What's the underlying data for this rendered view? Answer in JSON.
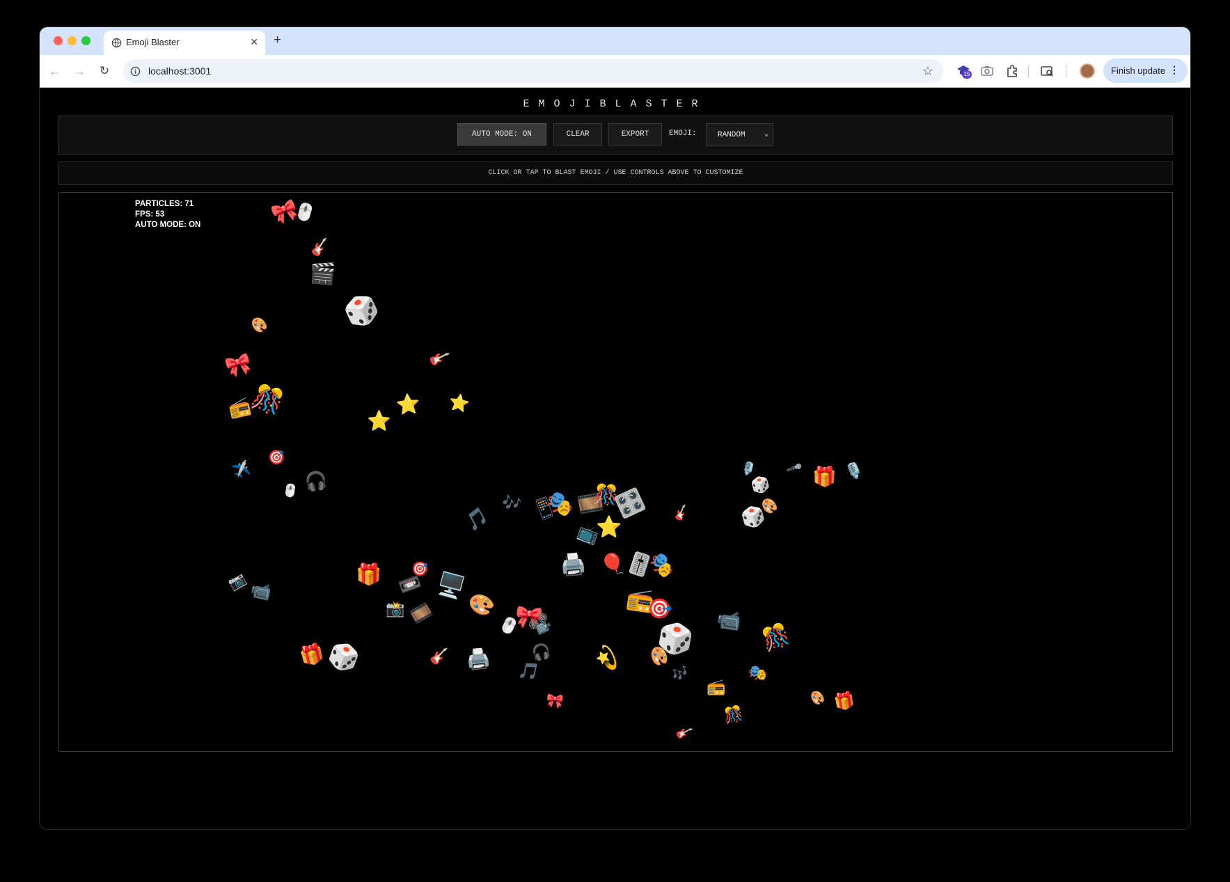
{
  "browser": {
    "tab_title": "Emoji Blaster",
    "close_glyph": "✕",
    "new_tab_glyph": "+",
    "back_glyph": "←",
    "forward_glyph": "→",
    "reload_glyph": "↻",
    "url": "localhost:3001",
    "star_glyph": "☆",
    "extension_badge": "15",
    "update_label": "Finish update",
    "menu_glyph": "⋮"
  },
  "app": {
    "title": "EMOJIBLASTER",
    "controls": {
      "auto_mode_label": "AUTO MODE: ON",
      "clear_label": "CLEAR",
      "export_label": "EXPORT",
      "emoji_label": "EMOJI:",
      "emoji_selected": "RANDOM",
      "caret_glyph": "⌄"
    },
    "instructions": "CLICK OR TAP TO BLAST EMOJI / USE CONTROLS ABOVE TO CUSTOMIZE",
    "stats": {
      "particles": "PARTICLES: 71",
      "fps": "FPS: 53",
      "auto_mode": "AUTO MODE: ON"
    }
  },
  "particles": [
    [
      "🎀",
      30
    ],
    [
      "🖱️",
      24
    ],
    [
      "🎸",
      22
    ],
    [
      "🎬",
      30
    ],
    [
      "🎲",
      40
    ],
    [
      "🎨",
      20
    ],
    [
      "🎀",
      30
    ],
    [
      "🎸",
      22
    ],
    [
      "⭐",
      28
    ],
    [
      "⭐",
      28
    ],
    [
      "📻",
      26
    ],
    [
      "🎊",
      36
    ],
    [
      "🎙️",
      18
    ],
    [
      "✈️",
      20
    ],
    [
      "🖱️",
      18
    ],
    [
      "🎧",
      26
    ],
    [
      "🎤",
      16
    ],
    [
      "🎁",
      28
    ],
    [
      "🎵",
      26
    ],
    [
      "🎶",
      22
    ],
    [
      "📱",
      28
    ],
    [
      "🎭",
      32
    ],
    [
      "🎞️",
      30
    ],
    [
      "🎊",
      28
    ],
    [
      "🎛️",
      32
    ],
    [
      "🎨",
      20
    ],
    [
      "🎲",
      28
    ],
    [
      "📺",
      24
    ],
    [
      "⭐",
      30
    ],
    [
      "🖨️",
      30
    ],
    [
      "🎈",
      30
    ],
    [
      "🎚️",
      30
    ],
    [
      "🎭",
      30
    ],
    [
      "🎸",
      18
    ],
    [
      "📻",
      32
    ],
    [
      "🎯",
      20
    ],
    [
      "🎯",
      28
    ],
    [
      "🎁",
      30
    ],
    [
      "📷",
      20
    ],
    [
      "📹",
      24
    ],
    [
      "📼",
      26
    ],
    [
      "🖥️",
      32
    ],
    [
      "🎨",
      30
    ],
    [
      "🎀",
      32
    ],
    [
      "📽️",
      26
    ],
    [
      "🎲",
      42
    ],
    [
      "🎁",
      28
    ],
    [
      "🎲",
      36
    ],
    [
      "🎸",
      22
    ],
    [
      "🖨️",
      28
    ],
    [
      "🎧",
      22
    ],
    [
      "💫",
      28
    ],
    [
      "🎨",
      24
    ],
    [
      "🎊",
      32
    ],
    [
      "📹",
      28
    ],
    [
      "🎙️",
      22
    ],
    [
      "🖱️",
      22
    ],
    [
      "📸",
      22
    ],
    [
      "🎞️",
      24
    ],
    [
      "🎵",
      24
    ],
    [
      "🎯",
      20
    ],
    [
      "🎨",
      18
    ],
    [
      "🎁",
      24
    ],
    [
      "🎀",
      20
    ],
    [
      "🎶",
      20
    ],
    [
      "⭐",
      24
    ],
    [
      "🎲",
      22
    ],
    [
      "🎸",
      18
    ],
    [
      "📻",
      22
    ],
    [
      "🎭",
      22
    ],
    [
      "🎊",
      22
    ]
  ]
}
